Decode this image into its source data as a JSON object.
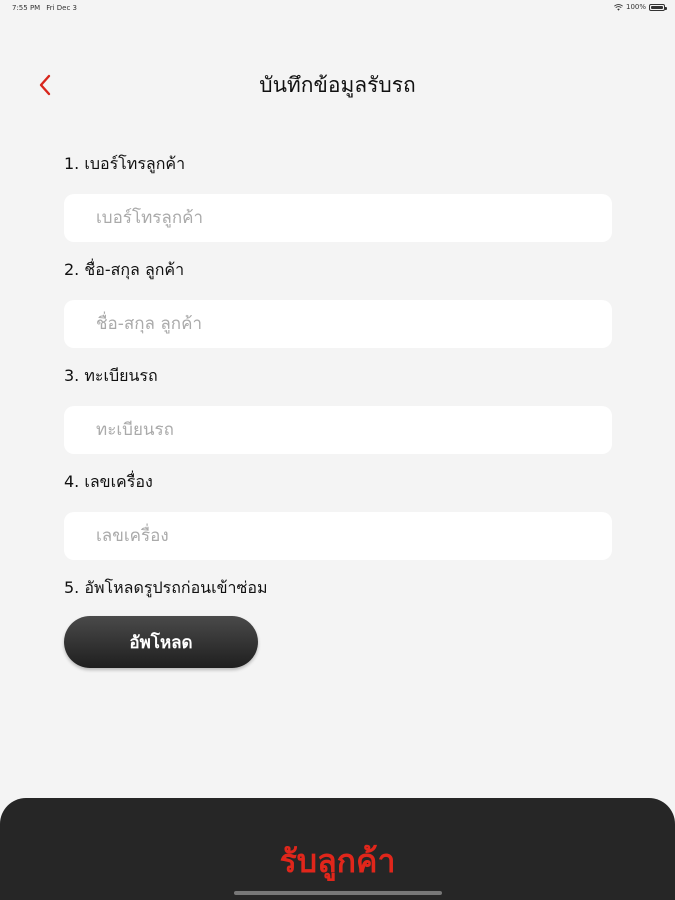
{
  "status_bar": {
    "time": "7:55 PM",
    "date": "Fri Dec 3",
    "battery": "100%"
  },
  "header": {
    "title": "บันทึกข้อมูลรับรถ",
    "back_icon": "chevron-left-icon",
    "accent_color": "#d8261c"
  },
  "form": {
    "fields": [
      {
        "label": "1. เบอร์โทรลูกค้า",
        "placeholder": "เบอร์โทรลูกค้า"
      },
      {
        "label": "2. ชื่อ-สกุล ลูกค้า",
        "placeholder": "ชื่อ-สกุล ลูกค้า"
      },
      {
        "label": "3. ทะเบียนรถ",
        "placeholder": "ทะเบียนรถ"
      },
      {
        "label": "4. เลขเครื่อง",
        "placeholder": "เลขเครื่อง"
      }
    ],
    "upload_label": "5. อัพโหลดรูปรถก่อนเข้าซ่อม",
    "upload_button": "อัพโหลด"
  },
  "bottom_bar": {
    "action_label": "รับลูกค้า",
    "action_color": "#e0261b"
  }
}
